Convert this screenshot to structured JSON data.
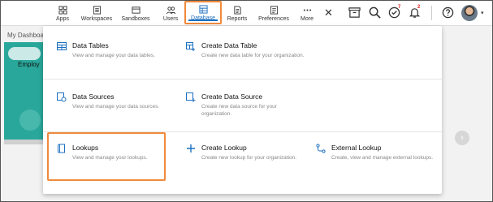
{
  "nav": {
    "items": [
      {
        "label": "Apps",
        "icon": "apps-grid-icon"
      },
      {
        "label": "Workspaces",
        "icon": "workspaces-icon"
      },
      {
        "label": "Sandboxes",
        "icon": "sandboxes-icon"
      },
      {
        "label": "Users",
        "icon": "users-icon"
      },
      {
        "label": "Database",
        "icon": "database-icon",
        "active": true
      },
      {
        "label": "Reports",
        "icon": "reports-icon"
      },
      {
        "label": "Preferences",
        "icon": "preferences-icon"
      },
      {
        "label": "More",
        "icon": "more-dots-icon"
      }
    ],
    "bell_badge": "2",
    "check_badge": "7"
  },
  "background": {
    "dashboard_label": "My Dashboard",
    "card_text": "Employ"
  },
  "menu": {
    "data_tables": {
      "title": "Data Tables",
      "desc": "View and manage your data tables."
    },
    "create_data_table": {
      "title": "Create Data Table",
      "desc": "Create new data table for your organization."
    },
    "data_sources": {
      "title": "Data Sources",
      "desc": "View and manage your data sources."
    },
    "create_data_source": {
      "title": "Create Data Source",
      "desc": "Create new data source for your organization."
    },
    "lookups": {
      "title": "Lookups",
      "desc": "View and manage your lookups."
    },
    "create_lookup": {
      "title": "Create Lookup",
      "desc": "Create new lookup for your organization."
    },
    "external_lookup": {
      "title": "External Lookup",
      "desc": "Create, view and manage external lookups."
    }
  },
  "colors": {
    "accent": "#1b6fc0",
    "highlight": "#f08a3c",
    "card": "#2aa79b"
  }
}
